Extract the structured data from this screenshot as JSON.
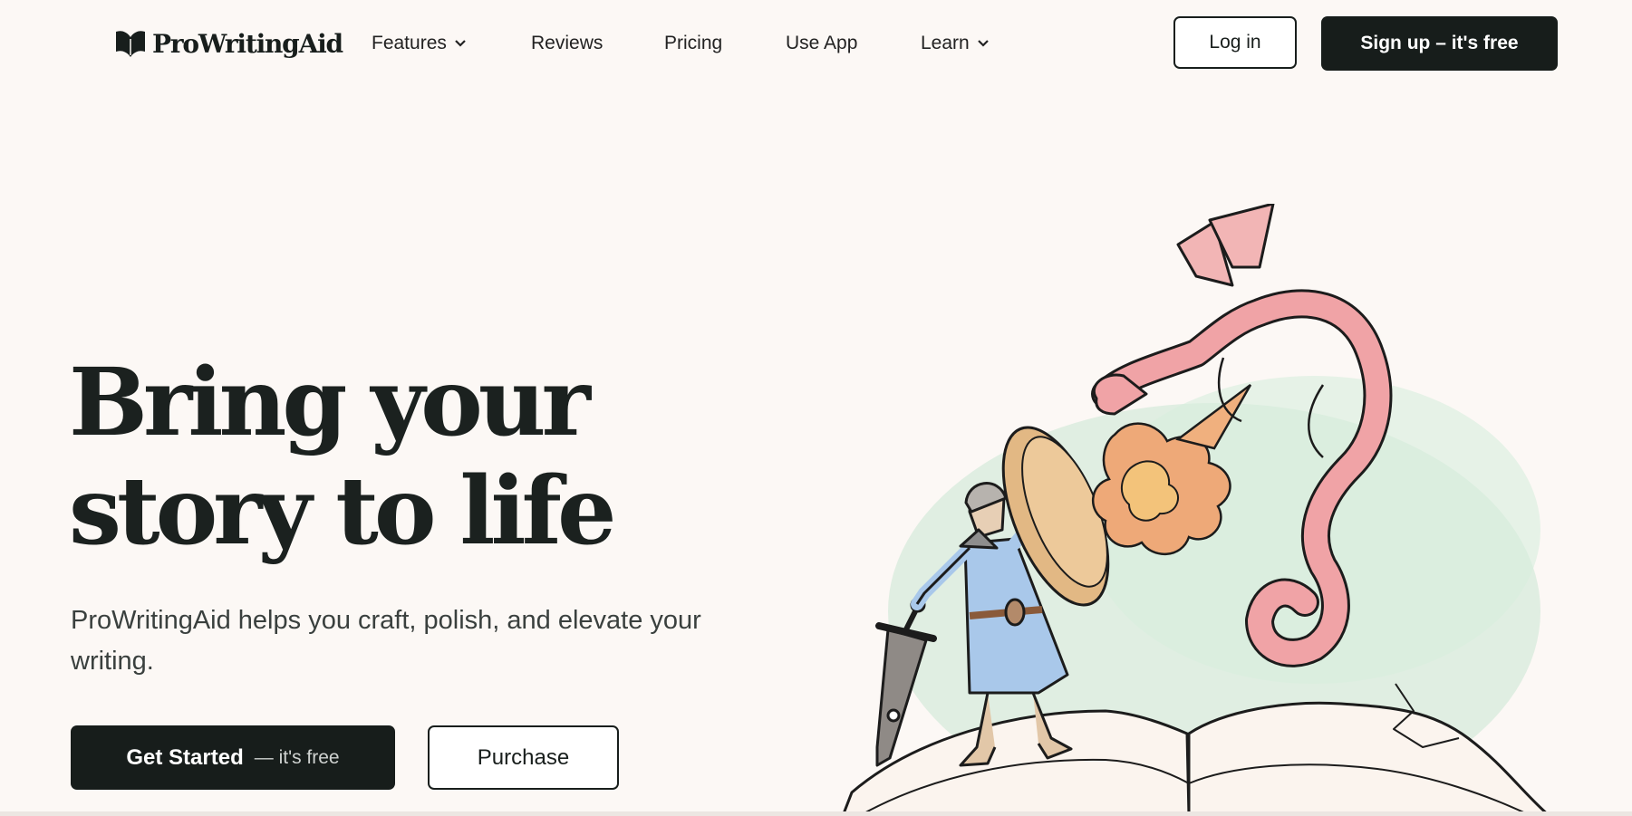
{
  "brand": {
    "name": "ProWritingAid",
    "logo_icon": "book-heart-icon"
  },
  "nav": {
    "items": [
      {
        "label": "Features",
        "has_dropdown": true
      },
      {
        "label": "Reviews",
        "has_dropdown": false
      },
      {
        "label": "Pricing",
        "has_dropdown": false
      },
      {
        "label": "Use App",
        "has_dropdown": false
      },
      {
        "label": "Learn",
        "has_dropdown": true
      }
    ]
  },
  "header": {
    "login_label": "Log in",
    "signup_label": "Sign up – it's free"
  },
  "hero": {
    "title_line1": "Bring your",
    "title_line2": "story to life",
    "subtitle": "ProWritingAid helps you craft, polish, and elevate your writing.",
    "cta_primary": "Get Started",
    "cta_primary_note": "— it's free",
    "cta_secondary": "Purchase",
    "illustration": "knight-and-dragon-on-open-book"
  },
  "colors": {
    "background": "#fcf8f5",
    "dark": "#171d1b",
    "text": "#181e1c",
    "dragon": "#f0a3a6",
    "knight_tunic": "#a9c8ea",
    "mist": "#c8e6d2"
  }
}
